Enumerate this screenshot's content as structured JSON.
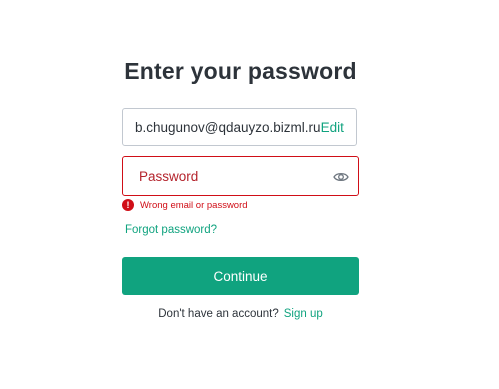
{
  "page": {
    "title": "Enter your password"
  },
  "email": {
    "value": "b.chugunov@qdauyzo.bizml.ru",
    "edit_label": "Edit"
  },
  "password": {
    "placeholder": "Password",
    "value": "",
    "toggle_icon": "eye-icon"
  },
  "error": {
    "icon": "!",
    "message": "Wrong email or password"
  },
  "forgot": {
    "label": "Forgot password?"
  },
  "continue": {
    "label": "Continue"
  },
  "signup": {
    "prompt": "Don't have an account?",
    "link_label": "Sign up"
  },
  "colors": {
    "accent": "#10a37f",
    "error": "#d00e17",
    "text": "#2d333a",
    "border": "#c2c8d0"
  }
}
